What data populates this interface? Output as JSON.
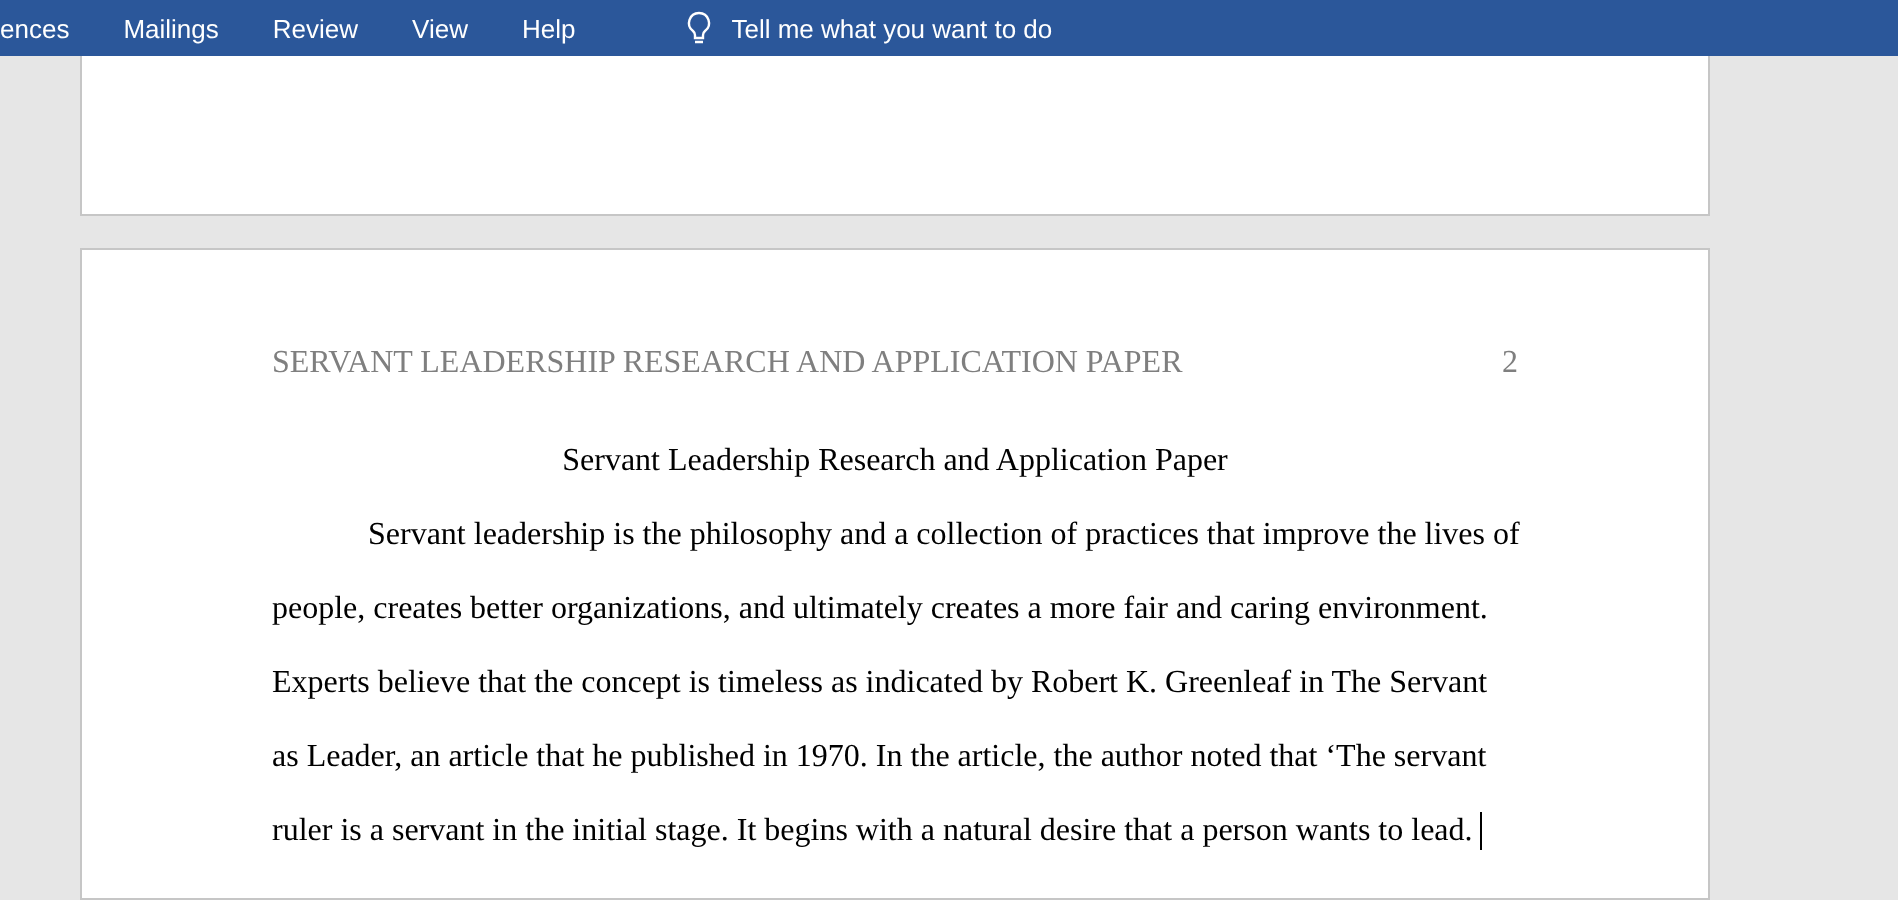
{
  "ribbon": {
    "tabs": [
      {
        "label": "ences"
      },
      {
        "label": "Mailings"
      },
      {
        "label": "Review"
      },
      {
        "label": "View"
      },
      {
        "label": "Help"
      }
    ],
    "tell_me": {
      "placeholder": "Tell me what you want to do"
    }
  },
  "page": {
    "header": {
      "title": "SERVANT LEADERSHIP RESEARCH AND APPLICATION PAPER",
      "page_number": "2"
    },
    "title": "Servant Leadership Research and Application Paper",
    "paragraph_lines": [
      "Servant leadership is the philosophy and a collection of practices that improve the lives of",
      "people, creates better organizations, and ultimately creates a more fair and caring environment.",
      "Experts believe that the concept is timeless as indicated by Robert K. Greenleaf in The Servant",
      "as Leader, an article that he published in 1970. In the article, the author noted that ‘The servant",
      "ruler is a servant in the initial stage. It begins with a natural desire that a person wants to lead."
    ]
  }
}
